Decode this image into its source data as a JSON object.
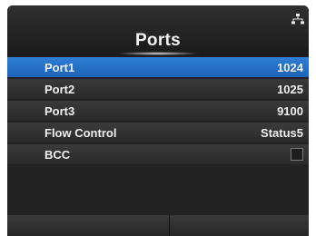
{
  "header": {
    "title": "Ports",
    "network_icon": "network-icon"
  },
  "rows": [
    {
      "label": "Port1",
      "value": "1024"
    },
    {
      "label": "Port2",
      "value": "1025"
    },
    {
      "label": "Port3",
      "value": "9100"
    },
    {
      "label": "Flow Control",
      "value": "Status5"
    },
    {
      "label": "BCC",
      "checked": false
    }
  ],
  "colors": {
    "selected": "#1f6fc7",
    "background": "#222222"
  },
  "selected_index": 0
}
